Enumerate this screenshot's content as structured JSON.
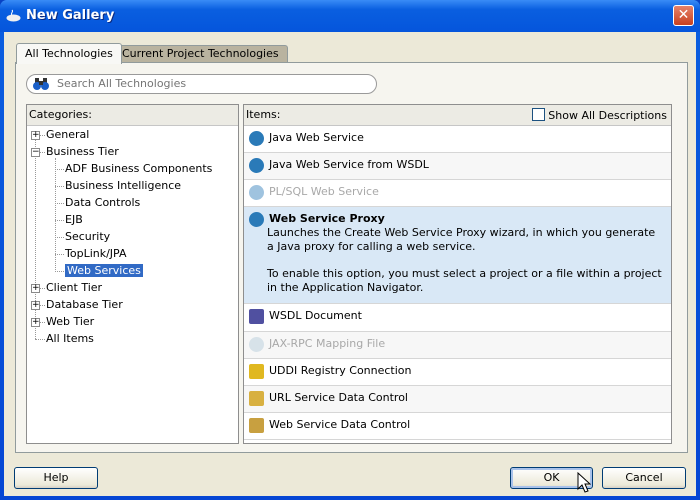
{
  "window": {
    "title": "New Gallery",
    "close_label": "✕"
  },
  "tabs": [
    {
      "label": "All Technologies",
      "active": true
    },
    {
      "label": "Current Project Technologies",
      "active": false
    }
  ],
  "search": {
    "placeholder": "Search All Technologies",
    "value": ""
  },
  "categories": {
    "header": "Categories:",
    "items": [
      {
        "label": "General",
        "level": 0,
        "expander": "+"
      },
      {
        "label": "Business Tier",
        "level": 0,
        "expander": "−"
      },
      {
        "label": "ADF Business Components",
        "level": 1
      },
      {
        "label": "Business Intelligence",
        "level": 1
      },
      {
        "label": "Data Controls",
        "level": 1
      },
      {
        "label": "EJB",
        "level": 1
      },
      {
        "label": "Security",
        "level": 1
      },
      {
        "label": "TopLink/JPA",
        "level": 1
      },
      {
        "label": "Web Services",
        "level": 1,
        "selected": true
      },
      {
        "label": "Client Tier",
        "level": 0,
        "expander": "+"
      },
      {
        "label": "Database Tier",
        "level": 0,
        "expander": "+"
      },
      {
        "label": "Web Tier",
        "level": 0,
        "expander": "+"
      },
      {
        "label": "All Items",
        "level": 0
      }
    ]
  },
  "items": {
    "header": "Items:",
    "show_all_label": "Show All Descriptions",
    "show_all_checked": false,
    "list": [
      {
        "label": "Java Web Service",
        "icon": "web-service-icon",
        "disabled": false
      },
      {
        "label": "Java Web Service from WSDL",
        "icon": "web-service-icon",
        "disabled": false
      },
      {
        "label": "PL/SQL Web Service",
        "icon": "web-service-icon",
        "disabled": true
      },
      {
        "label": "Web Service Proxy",
        "icon": "web-service-icon",
        "selected": true,
        "desc1": "Launches the Create Web Service Proxy wizard, in which you generate a Java proxy for calling a web service.",
        "desc2": "To enable this option, you must select a project or a file within a project in the Application Navigator."
      },
      {
        "label": "WSDL Document",
        "icon": "wsdl-document-icon",
        "disabled": false
      },
      {
        "label": "JAX-RPC Mapping File",
        "icon": "mapping-file-icon",
        "disabled": true
      },
      {
        "label": "UDDI Registry Connection",
        "icon": "uddi-connection-icon",
        "disabled": false
      },
      {
        "label": "URL Service Data Control",
        "icon": "url-data-control-icon",
        "disabled": false
      },
      {
        "label": "Web Service Data Control",
        "icon": "ws-data-control-icon",
        "disabled": false
      }
    ]
  },
  "buttons": {
    "help": "Help",
    "ok": "OK",
    "cancel": "Cancel"
  }
}
